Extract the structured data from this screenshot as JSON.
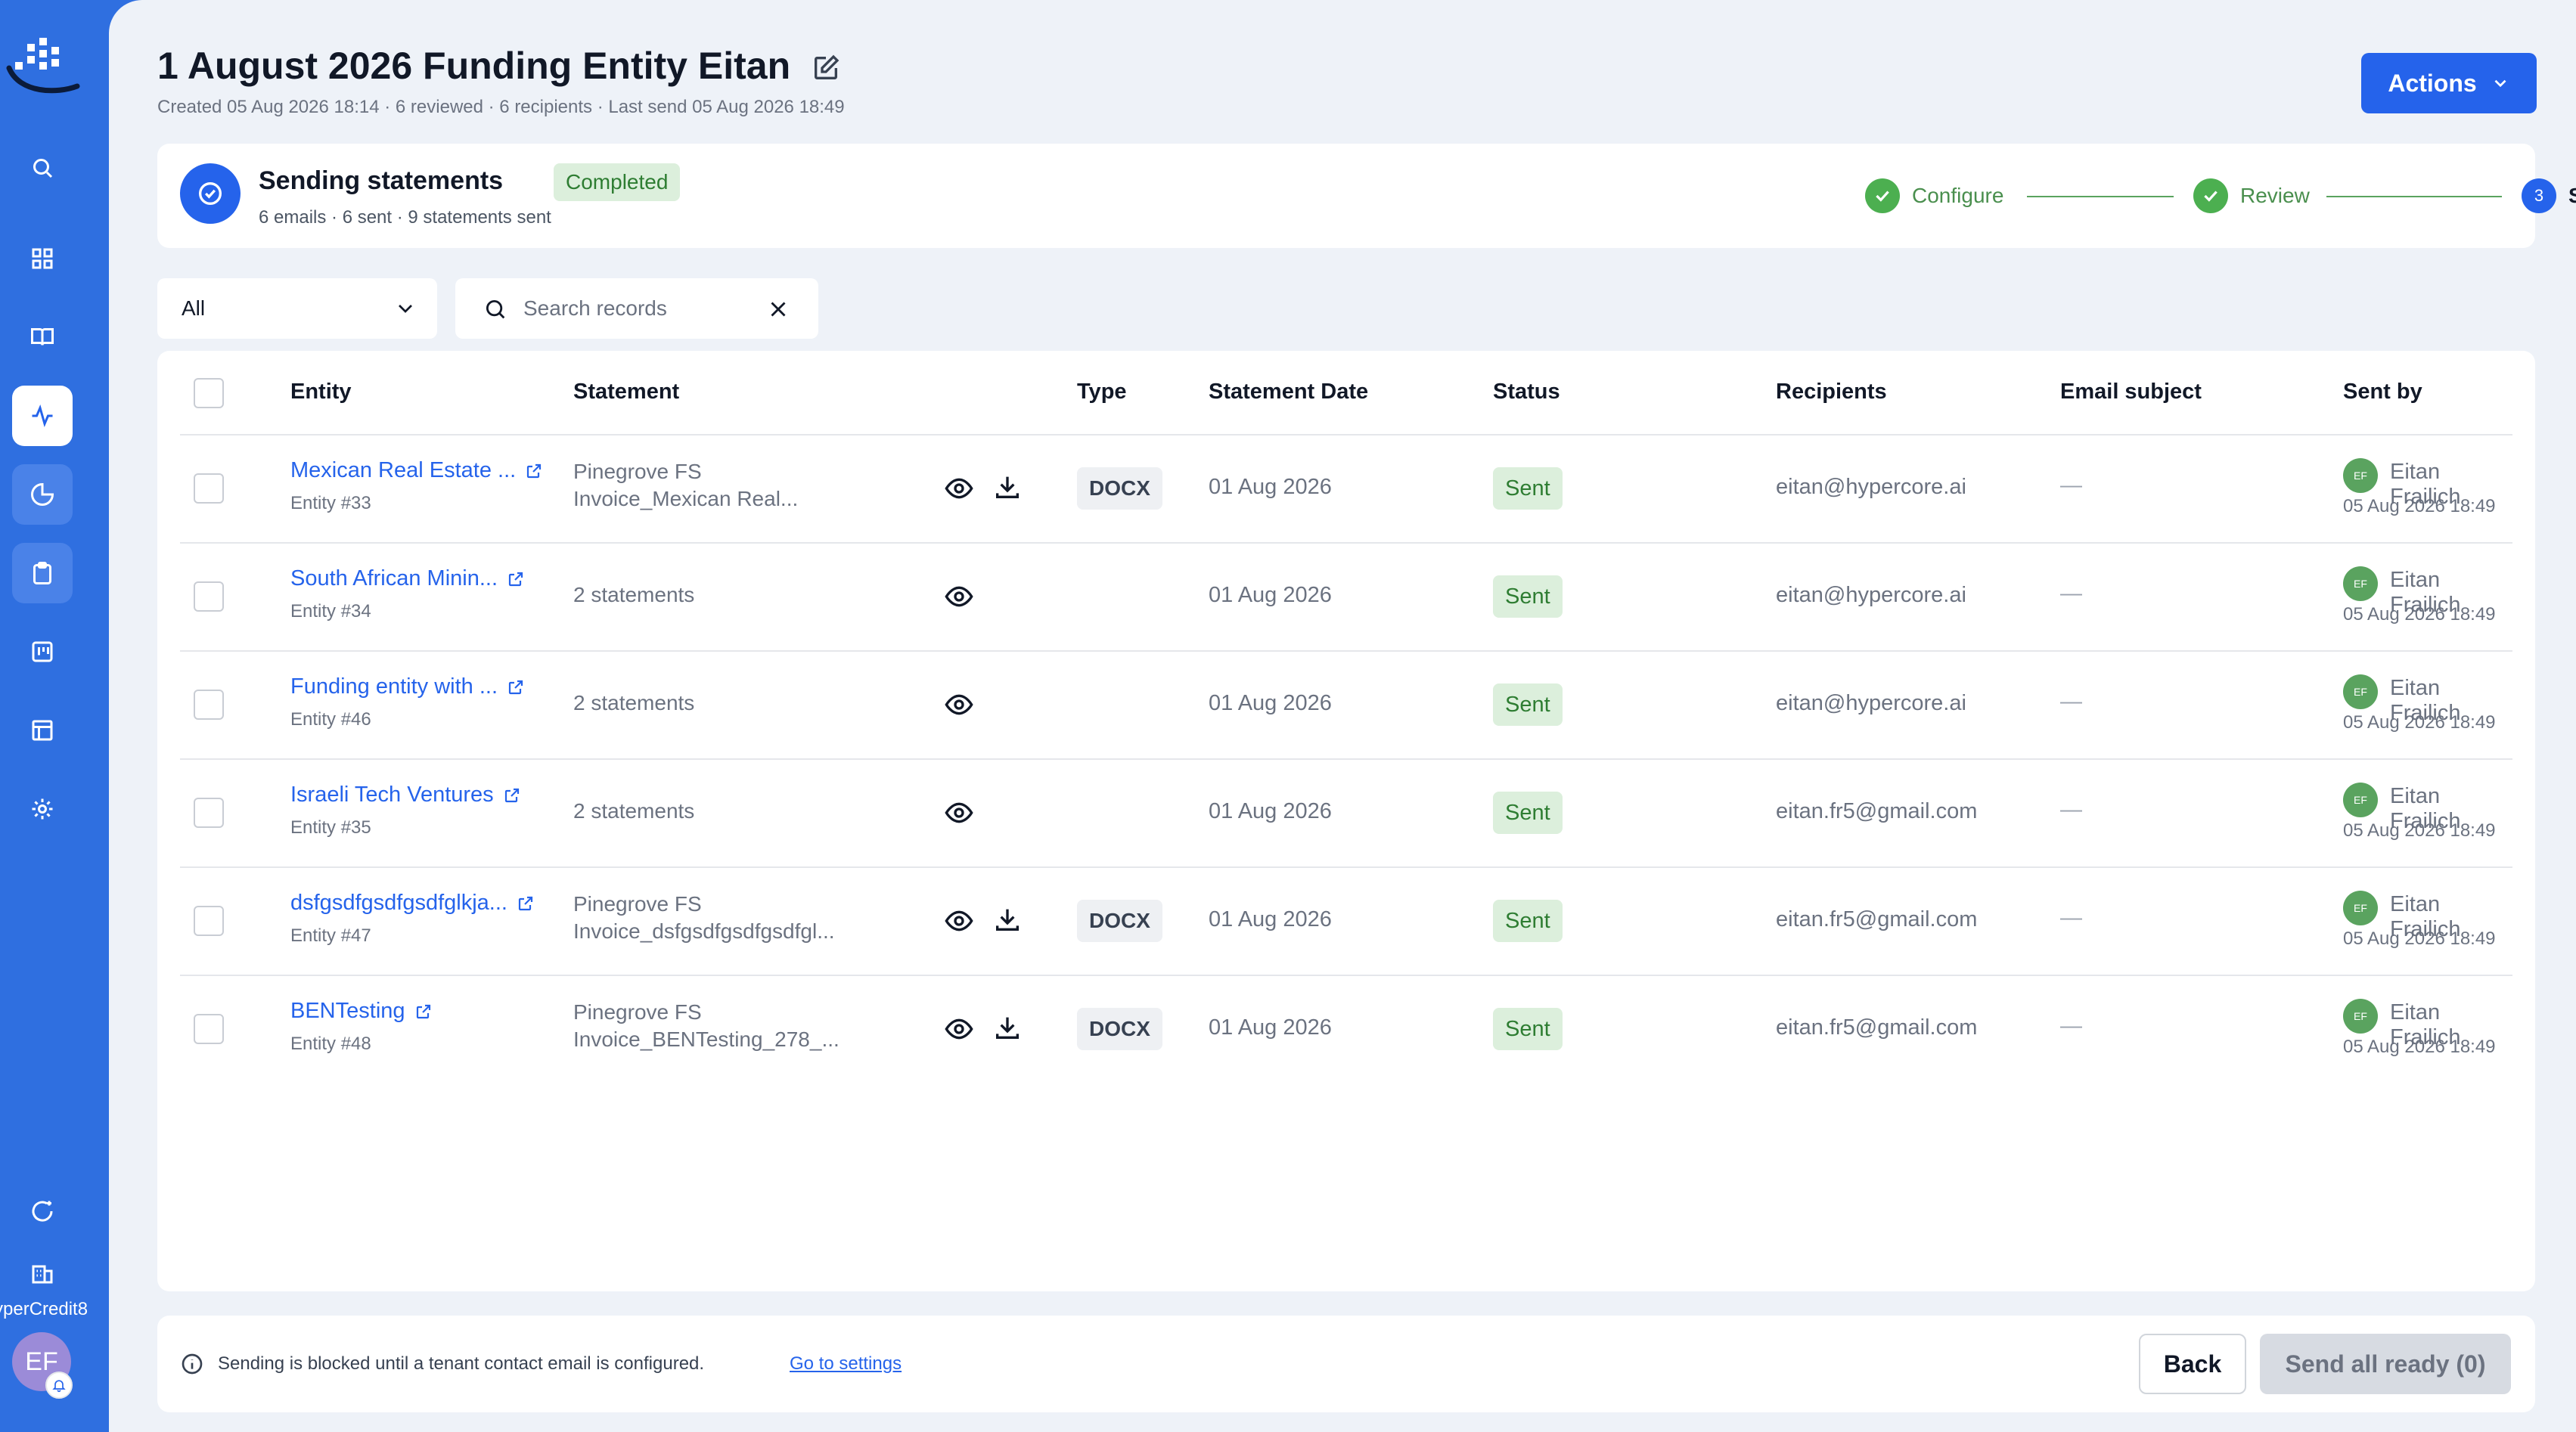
{
  "header": {
    "title": "1 August 2026 Funding Entity Eitan",
    "meta": "Created 05 Aug 2026 18:14 · 6 reviewed · 6 recipients · Last send 05 Aug 2026 18:49",
    "actions_label": "Actions"
  },
  "progress": {
    "title": "Sending statements",
    "status": "Completed",
    "summary": "6 emails · 6 sent · 9 statements sent",
    "steps": [
      {
        "label": "Configure",
        "state": "done"
      },
      {
        "label": "Review",
        "state": "done"
      },
      {
        "label": "Send",
        "state": "current",
        "number": "3"
      }
    ]
  },
  "filters": {
    "selected": "All",
    "search_placeholder": "Search records"
  },
  "table": {
    "columns": [
      "Entity",
      "Statement",
      "Type",
      "Statement Date",
      "Status",
      "Recipients",
      "Email subject",
      "Sent by"
    ],
    "rows": [
      {
        "entity": "Mexican Real Estate ...",
        "entity_id": "Entity #33",
        "statement_line1": "Pinegrove FS",
        "statement_line2": "Invoice_Mexican Real...",
        "type": "DOCX",
        "date": "01 Aug 2026",
        "status": "Sent",
        "recipients": "eitan@hypercore.ai",
        "subject": "—",
        "sender_initials": "EF",
        "sender": "Eitan Frailich",
        "sent_at": "05 Aug 2026 18:49"
      },
      {
        "entity": "South African Minin...",
        "entity_id": "Entity #34",
        "statement_line1": "2 statements",
        "statement_line2": "",
        "type": "",
        "date": "01 Aug 2026",
        "status": "Sent",
        "recipients": "eitan@hypercore.ai",
        "subject": "—",
        "sender_initials": "EF",
        "sender": "Eitan Frailich",
        "sent_at": "05 Aug 2026 18:49"
      },
      {
        "entity": "Funding entity with ...",
        "entity_id": "Entity #46",
        "statement_line1": "2 statements",
        "statement_line2": "",
        "type": "",
        "date": "01 Aug 2026",
        "status": "Sent",
        "recipients": "eitan@hypercore.ai",
        "subject": "—",
        "sender_initials": "EF",
        "sender": "Eitan Frailich",
        "sent_at": "05 Aug 2026 18:49"
      },
      {
        "entity": "Israeli Tech Ventures",
        "entity_id": "Entity #35",
        "statement_line1": "2 statements",
        "statement_line2": "",
        "type": "",
        "date": "01 Aug 2026",
        "status": "Sent",
        "recipients": "eitan.fr5@gmail.com",
        "subject": "—",
        "sender_initials": "EF",
        "sender": "Eitan Frailich",
        "sent_at": "05 Aug 2026 18:49"
      },
      {
        "entity": "dsfgsdfgsdfgsdfglkja...",
        "entity_id": "Entity #47",
        "statement_line1": "Pinegrove FS",
        "statement_line2": "Invoice_dsfgsdfgsdfgsdfgl...",
        "type": "DOCX",
        "date": "01 Aug 2026",
        "status": "Sent",
        "recipients": "eitan.fr5@gmail.com",
        "subject": "—",
        "sender_initials": "EF",
        "sender": "Eitan Frailich",
        "sent_at": "05 Aug 2026 18:49"
      },
      {
        "entity": "BENTesting",
        "entity_id": "Entity #48",
        "statement_line1": "Pinegrove FS",
        "statement_line2": "Invoice_BENTesting_278_...",
        "type": "DOCX",
        "date": "01 Aug 2026",
        "status": "Sent",
        "recipients": "eitan.fr5@gmail.com",
        "subject": "—",
        "sender_initials": "EF",
        "sender": "Eitan Frailich",
        "sent_at": "05 Aug 2026 18:49"
      }
    ]
  },
  "footer": {
    "notice": "Sending is blocked until a tenant contact email is configured.",
    "link": "Go to settings",
    "back_label": "Back",
    "send_all_label": "Send all ready (0)"
  },
  "sidebar": {
    "tenant": "yperCredit8",
    "user_initials": "EF",
    "icons": [
      "search-icon",
      "dashboard-grid-icon",
      "book-icon",
      "activity-icon",
      "pie-chart-icon",
      "clipboard-icon",
      "kanban-icon",
      "table-icon",
      "gear-icon",
      "refresh-sparkle-icon",
      "building-icon"
    ]
  },
  "colors": {
    "sidebar": "#2f6fe0",
    "primary": "#2563eb",
    "success": "#4caf50",
    "background": "#eef2f8"
  }
}
